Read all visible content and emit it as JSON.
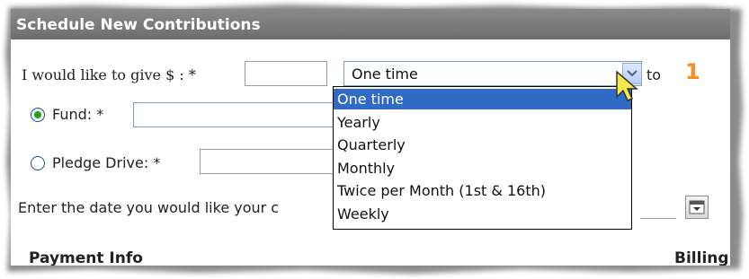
{
  "panel": {
    "title": "Schedule New Contributions"
  },
  "amount_row": {
    "label": "I would like to give $ : *",
    "amount_value": "",
    "frequency_selected": "One time",
    "to_label": "to",
    "callout_number": "1"
  },
  "fund_row": {
    "label": "Fund: *",
    "selected": true,
    "value": ""
  },
  "pledge_row": {
    "label": "Pledge Drive: *",
    "selected": false,
    "value": ""
  },
  "date_row": {
    "label": "Enter the date you would like your c"
  },
  "frequency_options": [
    "One time",
    "Yearly",
    "Quarterly",
    "Monthly",
    "Twice per Month (1st & 16th)",
    "Weekly"
  ],
  "sections": {
    "payment_info": "Payment Info",
    "billing": "Billing"
  },
  "colors": {
    "header_bg": "#7a7a7a",
    "dropdown_selected_bg": "#316ac5",
    "callout_orange": "#ff8c1a",
    "radio_selected": "#21a121"
  },
  "icons": {
    "dropdown_arrow": "chevron-down-icon",
    "calendar": "calendar-icon",
    "cursor": "pointer-cursor-icon"
  }
}
